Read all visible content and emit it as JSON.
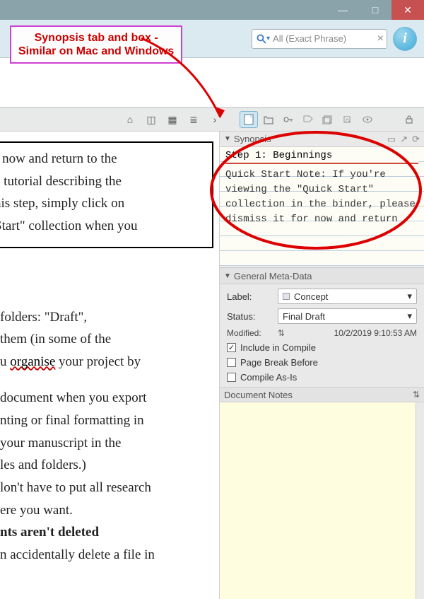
{
  "annotation": {
    "line1": "Synopsis tab and box -",
    "line2": "Similar on Mac and Windows"
  },
  "titlebar": {
    "minimize": "—",
    "maximize": "□",
    "close": "✕"
  },
  "search": {
    "placeholder": "All (Exact Phrase)"
  },
  "viewrow": {
    "icons": [
      "home-icon",
      "bookmark-icon",
      "corkboard-icon",
      "outliner-icon"
    ],
    "tabs": [
      "synopsis-tab",
      "snapshot-tab",
      "keywords-tab",
      "comments-tab",
      "related-tab",
      "custom-tab",
      "view-tab"
    ]
  },
  "inspector": {
    "synopsis_header": "Synopsis",
    "card_title": "Step 1: Beginnings",
    "card_body": "Quick Start Note: If you're viewing the \"Quick Start\" collection in the binder, please dismiss it for now and return",
    "meta_header": "General Meta-Data",
    "label_lbl": "Label:",
    "label_value": "Concept",
    "status_lbl": "Status:",
    "status_value": "Final Draft",
    "modified_lbl": "Modified:",
    "modified_value": "10/2/2019 9:10:53 AM",
    "include": "Include in Compile",
    "pagebreak": "Page Break Before",
    "compileas": "Compile As-Is",
    "notes_header": "Document Notes"
  },
  "editor": {
    "box_l1": "r now and return to the",
    "box_l2": "e tutorial describing the",
    "box_l3": "his step, simply click on",
    "box_l4": "Start\" collection when you",
    "p1": "folders: \"Draft\",",
    "p2": "them (in some of the",
    "p3a": "u ",
    "p3b": "organise",
    "p3c": " your project by",
    "p4": "document when you export",
    "p5": "nting or final formatting in",
    "p6": "your manuscript in the",
    "p7": "les and folders.)",
    "p8": "lon't have to put all research",
    "p9": "ere you want.",
    "p10": "nts aren't deleted",
    "p11": "n accidentally delete a file in"
  }
}
